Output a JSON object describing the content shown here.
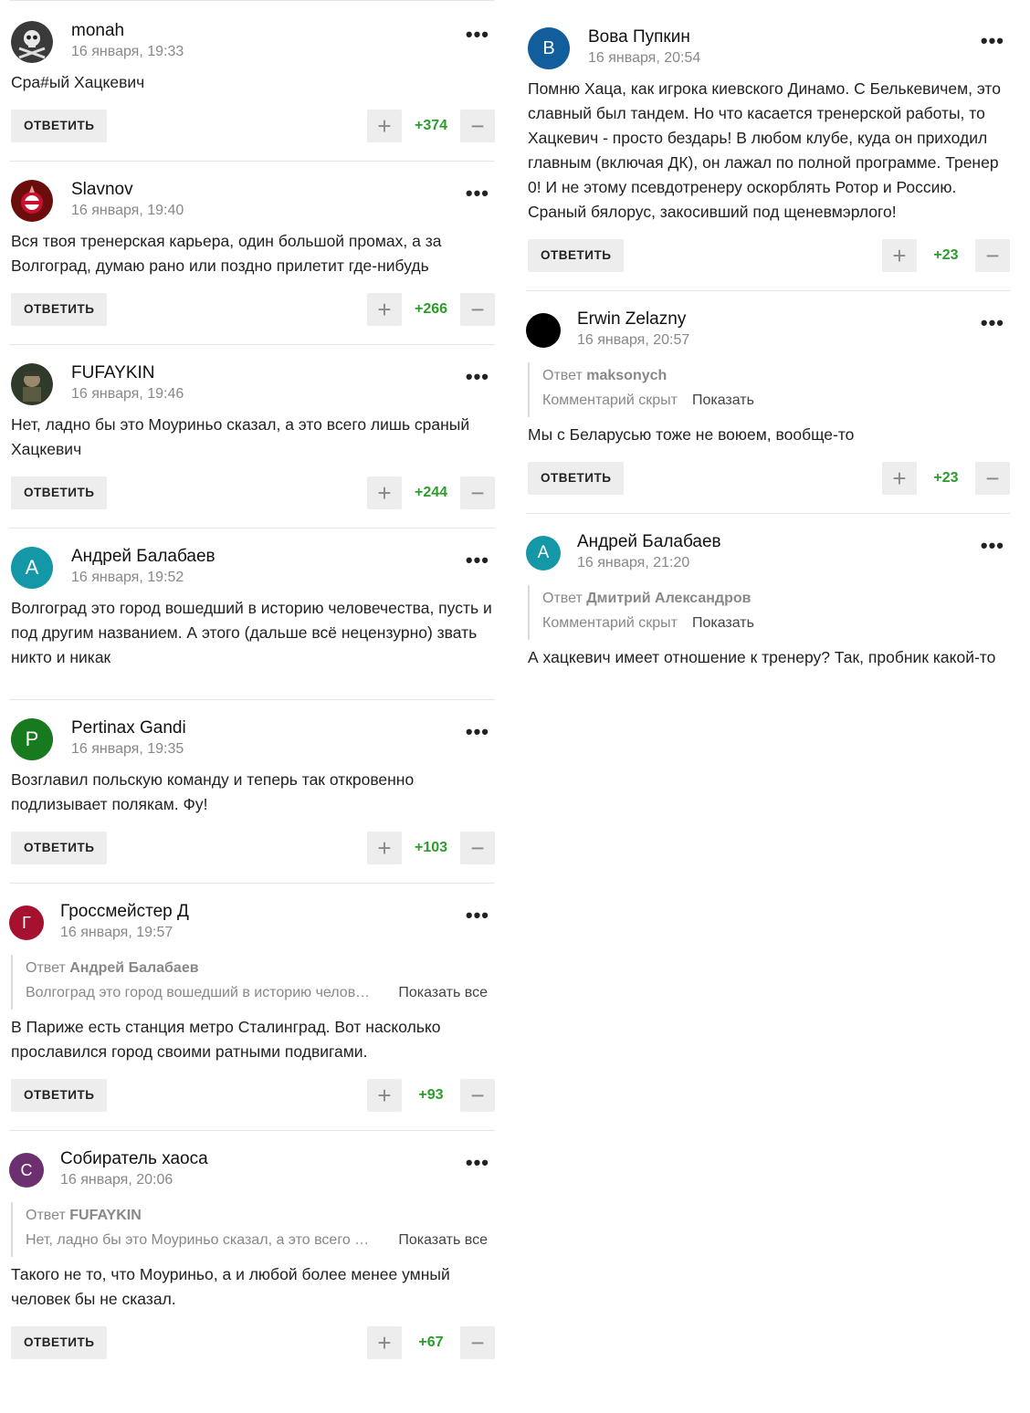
{
  "labels": {
    "reply": "ОТВЕТИТЬ",
    "reply_to": "Ответ",
    "hidden": "Комментарий скрыт",
    "show": "Показать",
    "show_all": "Показать все"
  },
  "left": [
    {
      "name": "monah",
      "date": "16 января, 19:33",
      "avatar": "skull-avatar",
      "text": "Сра#ый Хацкевич",
      "score": "+374"
    },
    {
      "name": "Slavnov",
      "date": "16 января, 19:40",
      "avatar": "spartak-avatar",
      "text": "Вся твоя тренерская карьера, один большой промах, а за Волгоград, думаю рано или поздно прилетит где-нибудь",
      "score": "+266"
    },
    {
      "name": "FUFAYKIN",
      "date": "16 января, 19:46",
      "avatar": "soldier-avatar",
      "text": "Нет, ладно бы это Моуриньо сказал, а это всего лишь сраный Хацкевич",
      "score": "+244"
    },
    {
      "name": "Андрей Балабаев",
      "date": "16 января, 19:52",
      "letter": "А",
      "color": "#1497a6",
      "text": "Волгоград это город вошедший в историю человечества, пусть и под другим названием. А этого (дальше всё нецензурно) звать никто и никак"
    },
    {
      "name": "Pertinax Gandi",
      "date": "16 января, 19:35",
      "letter": "P",
      "color": "#187a1e",
      "text": "Возглавил польскую команду и теперь так откровенно подлизывает полякам. Фу!",
      "score": "+103"
    },
    {
      "name": "Гроссмейстер Д",
      "date": "16 января, 19:57",
      "letter": "Г",
      "color": "#a5112f",
      "reply_author": "Андрей Балабаев",
      "reply_snippet": "Волгоград это город вошедший в историю человечества",
      "text": "В Париже есть станция метро Сталинград. Вот насколько прославился город своими ратными подвигами.",
      "score": "+93"
    },
    {
      "name": "Собиратель хаоса",
      "date": "16 января, 20:06",
      "letter": "С",
      "color": "#6c2f6f",
      "reply_author": "FUFAYKIN",
      "reply_snippet": "Нет, ладно бы это Моуриньо сказал, а это всего лишь",
      "text": "Такого не то, что Моуриньо, а и любой более менее умный человек бы не сказал.",
      "score": "+67"
    }
  ],
  "right": [
    {
      "name": "Вова Пупкин",
      "date": "16 января, 20:54",
      "letter": "В",
      "color": "#125d9b",
      "text": "Помню Хаца, как игрока киевского Динамо. С Белькевичем, это славный был тандем. Но что касается тренерской работы, то Хацкевич - просто бездарь! В любом клубе, куда он приходил главным (включая ДК), он лажал по полной программе. Тренер 0! И не этому псевдотренеру оскорблять Ротор и Россию. Сраный бялорус, закосивший под щеневмэрлого!",
      "score": "+23"
    },
    {
      "name": "Erwin Zelazny",
      "date": "16 января, 20:57",
      "letter": "",
      "color": "#000000",
      "reply_author": "maksonych",
      "text": "Мы с Беларусью тоже не воюем, вообще-то",
      "score": "+23"
    },
    {
      "name": "Андрей Балабаев",
      "date": "16 января, 21:20",
      "letter": "А",
      "color": "#1497a6",
      "reply_author": "Дмитрий Александров",
      "text": "А хацкевич имеет отношение к тренеру? Так, пробник какой-то"
    }
  ]
}
